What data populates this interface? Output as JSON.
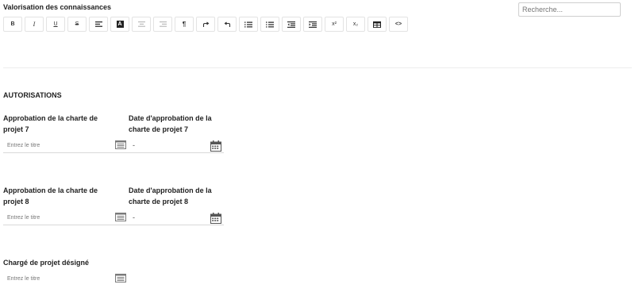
{
  "editor": {
    "title": "Valorisation des connaissances",
    "toolbar": [
      {
        "icon": "bold-icon",
        "label": "B"
      },
      {
        "icon": "italic-icon",
        "label": "I"
      },
      {
        "icon": "underline-icon",
        "label": "U"
      },
      {
        "icon": "strikethrough-icon",
        "label": "S"
      },
      {
        "icon": "align-left-icon",
        "label": ""
      },
      {
        "icon": "text-color-icon",
        "label": "A"
      },
      {
        "icon": "align-center-icon",
        "label": ""
      },
      {
        "icon": "align-right-icon",
        "label": ""
      },
      {
        "icon": "paragraph-icon",
        "label": "¶"
      },
      {
        "icon": "redo-icon",
        "label": ""
      },
      {
        "icon": "undo-icon",
        "label": ""
      },
      {
        "icon": "ordered-list-icon",
        "label": ""
      },
      {
        "icon": "unordered-list-icon",
        "label": ""
      },
      {
        "icon": "outdent-icon",
        "label": ""
      },
      {
        "icon": "indent-icon",
        "label": ""
      },
      {
        "icon": "superscript-icon",
        "label": "x²"
      },
      {
        "icon": "subscript-icon",
        "label": "x₂"
      },
      {
        "icon": "table-icon",
        "label": ""
      },
      {
        "icon": "code-icon",
        "label": "<>"
      }
    ]
  },
  "search": {
    "placeholder": "Recherche..."
  },
  "authorisations": {
    "title": "AUTORISATIONS",
    "charte7": {
      "label_line1": "Approbation de la charte de",
      "label_line2": "projet 7",
      "placeholder": "Entrez le titre"
    },
    "date7": {
      "label_line1": "Date d'approbation de la",
      "label_line2": "charte de projet 7",
      "value": "-"
    },
    "charte8": {
      "label_line1": "Approbation de la charte de",
      "label_line2": "projet 8",
      "placeholder": "Entrez le titre"
    },
    "date8": {
      "label_line1": "Date d'approbation de la",
      "label_line2": "charte de projet 8",
      "value": "-"
    },
    "charge": {
      "label": "Chargé de projet désigné",
      "placeholder": "Entrez le titre"
    }
  },
  "colors": {
    "icon_gray": "#7a7a7a",
    "border": "#d9d9d9"
  }
}
